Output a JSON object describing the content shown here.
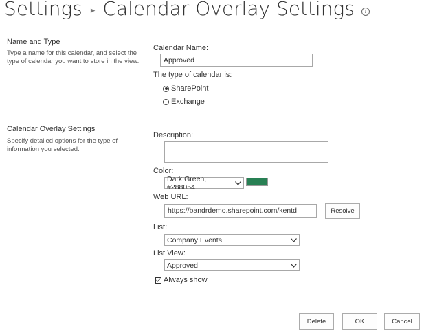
{
  "header": {
    "crumb": "Settings",
    "title": "Calendar Overlay Settings"
  },
  "name_section": {
    "title": "Name and Type",
    "description": "Type a name for this calendar, and select the type of calendar you want to store in the view."
  },
  "overlay_section": {
    "title": "Calendar Overlay Settings",
    "description": "Specify detailed options for the type of information you selected."
  },
  "form": {
    "calendar_name_label": "Calendar Name:",
    "calendar_name_value": "Approved",
    "type_label": "The type of calendar is:",
    "type_options": [
      "SharePoint",
      "Exchange"
    ],
    "description_label": "Description:",
    "description_value": "",
    "color_label": "Color:",
    "color_value": "Dark Green, #288054",
    "color_swatch": "#288054",
    "web_url_label": "Web URL:",
    "web_url_value": "https://bandrdemo.sharepoint.com/kentd",
    "resolve_label": "Resolve",
    "list_label": "List:",
    "list_value": "Company Events",
    "list_view_label": "List View:",
    "list_view_value": "Approved",
    "always_show_label": "Always show"
  },
  "buttons": {
    "delete": "Delete",
    "ok": "OK",
    "cancel": "Cancel"
  }
}
